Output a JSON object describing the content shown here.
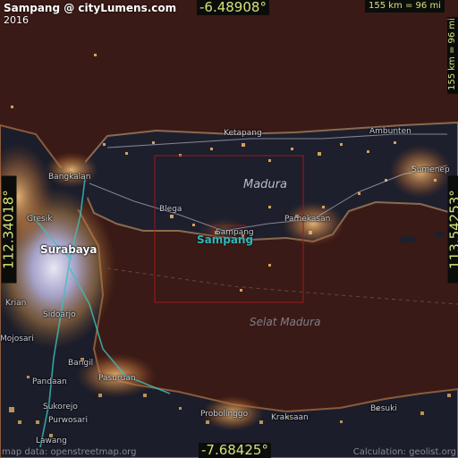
{
  "header": {
    "title": "Sampang @ cityLumens.com",
    "year": "2016"
  },
  "coords": {
    "lat_top": "-6.48908°",
    "lat_bottom": "-7.68425°",
    "lon_left": "112.34018°",
    "lon_right": "113.54253°"
  },
  "scale": {
    "top": "155 km = 96 mi",
    "right": "155 km = 96 mi"
  },
  "labels": {
    "island": "Madura",
    "sea": "Selat Madura",
    "city": "Sampang",
    "places": {
      "ketapang": "Ketapang",
      "ambunten": "Ambunten",
      "sumenep": "Sumenep",
      "bangkalan": "Bangkalan",
      "blega": "Blega",
      "sampang_small": "Sampang",
      "pamekasan": "Pamekasan",
      "gresik": "Gresik",
      "surabaya": "Surabaya",
      "krian": "Krian",
      "sidoarjo": "Sidoarjo",
      "mojosari": "Mojosari",
      "bangil": "Bangil",
      "pandaan": "Pandaan",
      "pasuruan": "Pasuruan",
      "sukorejo": "Sukorejo",
      "purwosari": "Purwosari",
      "lawang": "Lawang",
      "probolinggo": "Probolinggo",
      "kraksaan": "Kraksaan",
      "besuki": "Besuki"
    }
  },
  "footer": {
    "attribution_left": "map data: openstreetmap.org",
    "attribution_right": "Calculation: geolist.org"
  },
  "colors": {
    "sea": "#3a1a16",
    "land": "#1b1d2a",
    "lights": "#f2b866",
    "city_core": "#e6e6ff",
    "road": "#3fc0c0",
    "box": "#a01818"
  }
}
